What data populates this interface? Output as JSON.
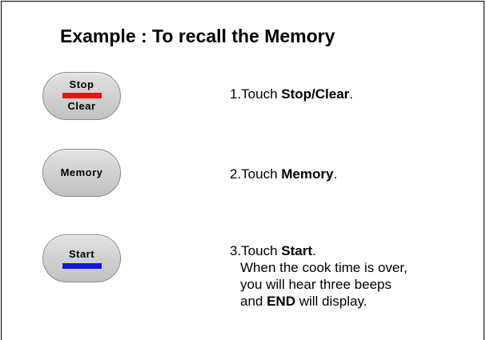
{
  "title": "Example : To recall the Memory",
  "buttons": {
    "stop_clear": {
      "top_label": "Stop",
      "bottom_label": "Clear",
      "bar_color": "#ee1111"
    },
    "memory": {
      "label": "Memory"
    },
    "start": {
      "label": "Start",
      "bar_color": "#1111ee"
    }
  },
  "steps": [
    {
      "prefix": "1.Touch ",
      "bold": "Stop/Clear",
      "suffix": "."
    },
    {
      "prefix": "2.Touch ",
      "bold": "Memory",
      "suffix": "."
    },
    {
      "prefix": "3.Touch ",
      "bold": "Start",
      "suffix": ".",
      "detail_line1": "When the cook time is over,",
      "detail_line2": "you will hear three beeps",
      "detail_line3_bold": "END",
      "detail_line3_prefix": "and ",
      "detail_line3_suffix": " will display."
    }
  ]
}
